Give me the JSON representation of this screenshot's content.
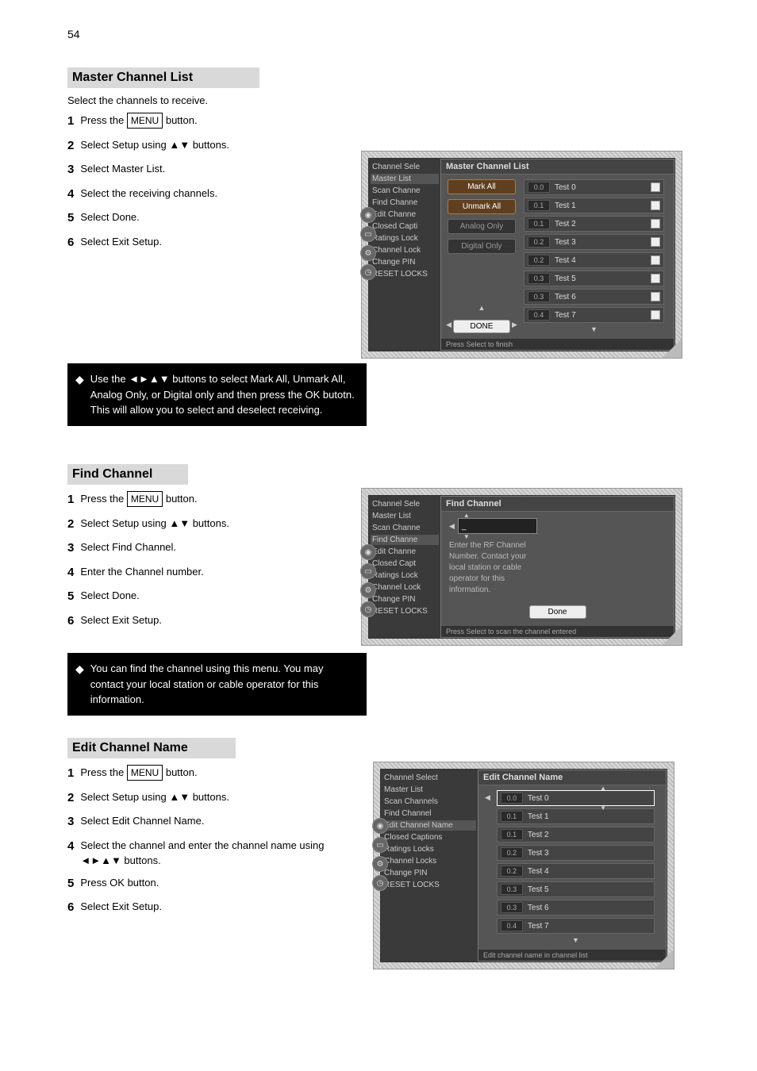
{
  "page_number": "54",
  "sections": {
    "master": {
      "heading": "Master Channel List",
      "para": "Select the channels to receive.",
      "steps": [
        {
          "n": "1",
          "body_a": "Press the ",
          "btn": "MENU",
          "body_b": " button."
        },
        {
          "n": "2",
          "body_a": "Select Setup using ▲▼ buttons."
        },
        {
          "n": "3",
          "body_a": "Select Master List."
        },
        {
          "n": "4",
          "body_a": "Select the receiving channels."
        },
        {
          "n": "5",
          "body_a": "Select Done."
        },
        {
          "n": "6",
          "body_a": "Select Exit Setup."
        }
      ],
      "note": "Use the ◄►▲▼ buttons to select Mark All, Unmark All, Analog Only, or Digital only and then press the OK butotn. This will allow you to select and deselect receiving.",
      "shot": {
        "title": "Master Channel List",
        "sidebar": [
          "Channel Sele",
          "Master List",
          "Scan Channe",
          "Find Channe",
          "Edit Channe",
          "Closed Capti",
          "Ratings Lock",
          "Channel Lock",
          "Change PIN",
          "RESET LOCKS"
        ],
        "actions": [
          {
            "label": "Mark All",
            "style": "brown"
          },
          {
            "label": "Unmark All",
            "style": "brown"
          },
          {
            "label": "Analog Only",
            "style": "gray"
          },
          {
            "label": "Digital Only",
            "style": "gray"
          }
        ],
        "done": "DONE",
        "channels": [
          {
            "num": "0.0",
            "name": "Test 0"
          },
          {
            "num": "0.1",
            "name": "Test 1"
          },
          {
            "num": "0.1",
            "name": "Test 2"
          },
          {
            "num": "0.2",
            "name": "Test 3"
          },
          {
            "num": "0.2",
            "name": "Test 4"
          },
          {
            "num": "0.3",
            "name": "Test 5"
          },
          {
            "num": "0.3",
            "name": "Test 6"
          },
          {
            "num": "0.4",
            "name": "Test 7"
          }
        ],
        "footer": "Press Select to finish"
      }
    },
    "find": {
      "heading": "Find Channel",
      "steps": [
        {
          "n": "1",
          "body_a": "Press the ",
          "btn": "MENU",
          "body_b": " button."
        },
        {
          "n": "2",
          "body_a": "Select Setup using ▲▼ buttons."
        },
        {
          "n": "3",
          "body_a": "Select Find Channel."
        },
        {
          "n": "4",
          "body_a": "Enter the Channel number."
        },
        {
          "n": "5",
          "body_a": "Select Done."
        },
        {
          "n": "6",
          "body_a": "Select Exit Setup."
        }
      ],
      "note": "You can find the channel using this menu. You may contact your local station or cable operator for this information.",
      "shot": {
        "title": "Find Channel",
        "sidebar": [
          "Channel Sele",
          "Master List",
          "Scan Channe",
          "Find Channe",
          "Edit Channe",
          "Closed Capt",
          "Ratings Lock",
          "Channel Lock",
          "Change PIN",
          "RESET LOCKS"
        ],
        "hint": "Enter the RF Channel Number. Contact your local station or cable operator for this information.",
        "done": "Done",
        "footer": "Press Select to scan the channel entered"
      }
    },
    "edit": {
      "heading": "Edit Channel Name",
      "steps": [
        {
          "n": "1",
          "body_a": "Press the ",
          "btn": "MENU",
          "body_b": " button."
        },
        {
          "n": "2",
          "body_a": "Select Setup using ▲▼ buttons."
        },
        {
          "n": "3",
          "body_a": "Select Edit Channel Name."
        },
        {
          "n": "4",
          "body_a": "Select the channel and enter the channel name using ◄►▲▼ buttons."
        },
        {
          "n": "5",
          "body_a": "Press OK button."
        },
        {
          "n": "6",
          "body_a": "Select Exit Setup."
        }
      ],
      "shot": {
        "title": "Edit Channel Name",
        "sidebar": [
          "Channel Select",
          "Master List",
          "Scan Channels",
          "Find Channel",
          "Edit Channel Name",
          "Closed Captions",
          "Ratings Locks",
          "Channel Locks",
          "Change PIN",
          "RESET LOCKS"
        ],
        "channels": [
          {
            "num": "0.0",
            "name": "Test 0"
          },
          {
            "num": "0.1",
            "name": "Test 1"
          },
          {
            "num": "0.1",
            "name": "Test 2"
          },
          {
            "num": "0.2",
            "name": "Test 3"
          },
          {
            "num": "0.2",
            "name": "Test 4"
          },
          {
            "num": "0.3",
            "name": "Test 5"
          },
          {
            "num": "0.3",
            "name": "Test 6"
          },
          {
            "num": "0.4",
            "name": "Test 7"
          }
        ],
        "footer": "Edit channel name in channel list"
      }
    }
  }
}
